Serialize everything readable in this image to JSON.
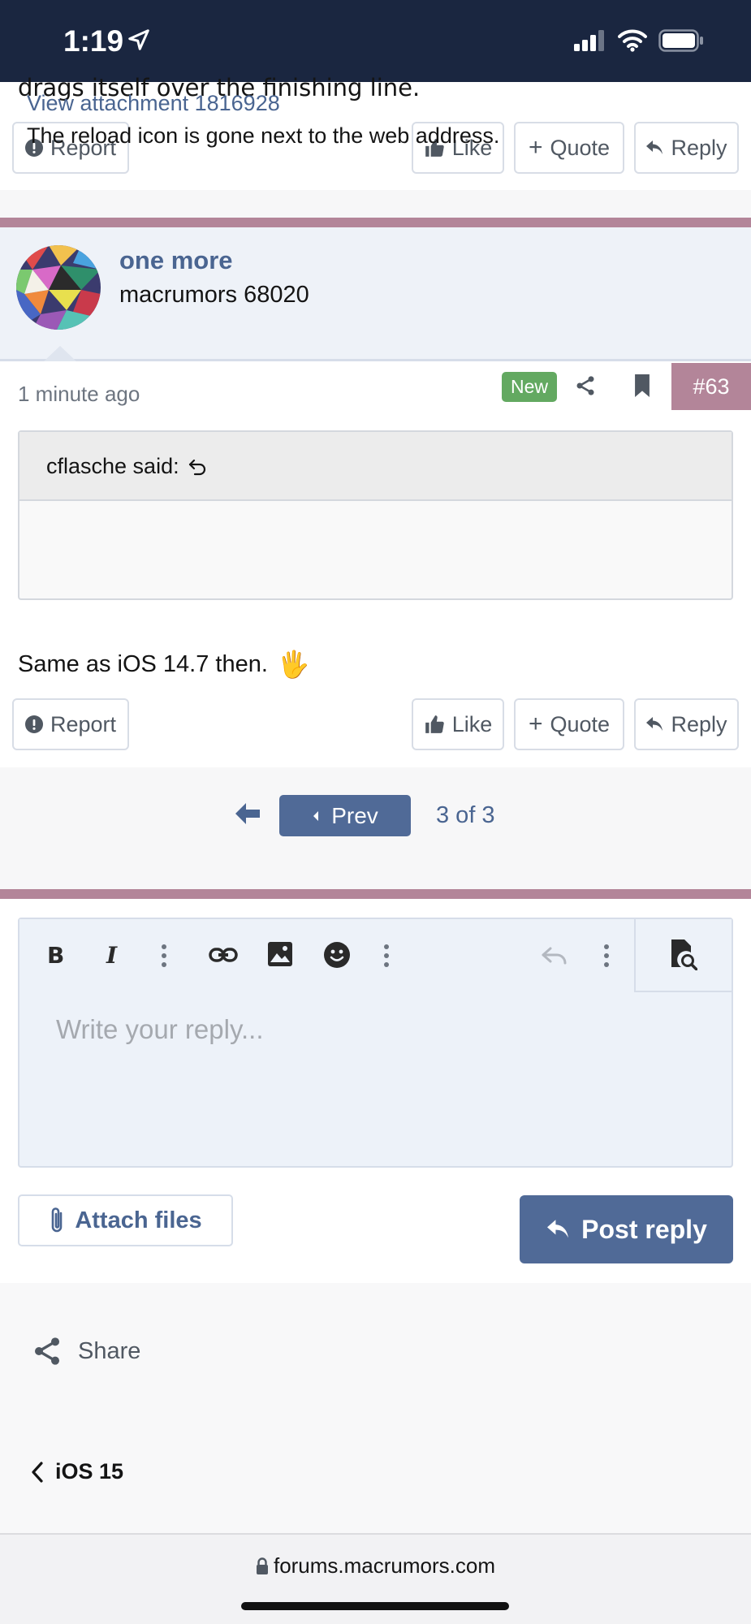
{
  "status_bar": {
    "time": "1:19"
  },
  "prev_post": {
    "partial_text": "drags itself over the finishing line.",
    "actions": {
      "report": "Report",
      "like": "Like",
      "quote": "Quote",
      "reply": "Reply"
    }
  },
  "post": {
    "username": "one more",
    "user_title": "macrumors 68020",
    "time": "1 minute ago",
    "new_badge": "New",
    "post_number": "#63",
    "quote": {
      "author": "cflasche said:",
      "attachment_link": "View attachment 1816928",
      "text": "The reload icon is gone next to the web address."
    },
    "body": "Same as iOS 14.7 then.",
    "emoji": "🖐",
    "actions": {
      "report": "Report",
      "like": "Like",
      "quote": "Quote",
      "reply": "Reply"
    }
  },
  "pagination": {
    "prev_label": "Prev",
    "page_info": "3 of 3"
  },
  "editor": {
    "placeholder": "Write your reply..."
  },
  "reply_actions": {
    "attach_label": "Attach files",
    "post_reply_label": "Post reply"
  },
  "footer": {
    "share_label": "Share",
    "breadcrumb": "iOS 15"
  },
  "browser": {
    "url": "forums.macrumors.com"
  },
  "colors": {
    "accent": "#506a97",
    "post_number_bg": "#b38599",
    "new_badge": "#63a961",
    "link": "#4a6591"
  }
}
